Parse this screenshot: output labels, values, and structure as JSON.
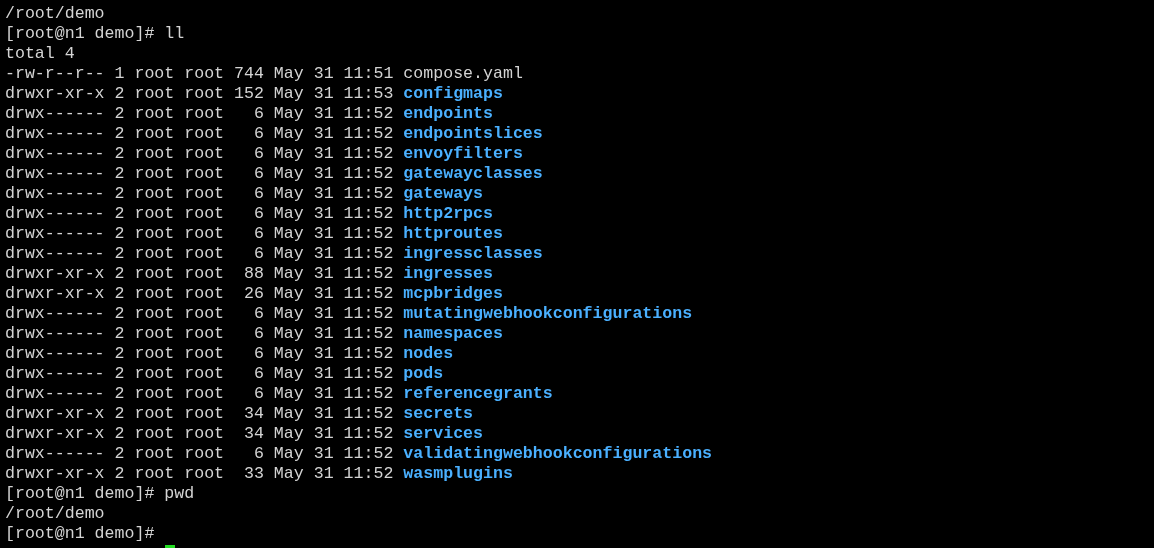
{
  "terminal": {
    "lines": [
      {
        "kind": "output",
        "text": "/root/demo"
      },
      {
        "kind": "prompt",
        "text": "[root@n1 demo]# ll"
      },
      {
        "kind": "output",
        "text": "total 4"
      },
      {
        "kind": "file",
        "meta": "-rw-r--r-- 1 root root 744 May 31 11:51",
        "name": "compose.yaml"
      },
      {
        "kind": "directory",
        "meta": "drwxr-xr-x 2 root root 152 May 31 11:53",
        "name": "configmaps"
      },
      {
        "kind": "directory",
        "meta": "drwx------ 2 root root   6 May 31 11:52",
        "name": "endpoints"
      },
      {
        "kind": "directory",
        "meta": "drwx------ 2 root root   6 May 31 11:52",
        "name": "endpointslices"
      },
      {
        "kind": "directory",
        "meta": "drwx------ 2 root root   6 May 31 11:52",
        "name": "envoyfilters"
      },
      {
        "kind": "directory",
        "meta": "drwx------ 2 root root   6 May 31 11:52",
        "name": "gatewayclasses"
      },
      {
        "kind": "directory",
        "meta": "drwx------ 2 root root   6 May 31 11:52",
        "name": "gateways"
      },
      {
        "kind": "directory",
        "meta": "drwx------ 2 root root   6 May 31 11:52",
        "name": "http2rpcs"
      },
      {
        "kind": "directory",
        "meta": "drwx------ 2 root root   6 May 31 11:52",
        "name": "httproutes"
      },
      {
        "kind": "directory",
        "meta": "drwx------ 2 root root   6 May 31 11:52",
        "name": "ingressclasses"
      },
      {
        "kind": "directory",
        "meta": "drwxr-xr-x 2 root root  88 May 31 11:52",
        "name": "ingresses"
      },
      {
        "kind": "directory",
        "meta": "drwxr-xr-x 2 root root  26 May 31 11:52",
        "name": "mcpbridges"
      },
      {
        "kind": "directory",
        "meta": "drwx------ 2 root root   6 May 31 11:52",
        "name": "mutatingwebhookconfigurations"
      },
      {
        "kind": "directory",
        "meta": "drwx------ 2 root root   6 May 31 11:52",
        "name": "namespaces"
      },
      {
        "kind": "directory",
        "meta": "drwx------ 2 root root   6 May 31 11:52",
        "name": "nodes"
      },
      {
        "kind": "directory",
        "meta": "drwx------ 2 root root   6 May 31 11:52",
        "name": "pods"
      },
      {
        "kind": "directory",
        "meta": "drwx------ 2 root root   6 May 31 11:52",
        "name": "referencegrants"
      },
      {
        "kind": "directory",
        "meta": "drwxr-xr-x 2 root root  34 May 31 11:52",
        "name": "secrets"
      },
      {
        "kind": "directory",
        "meta": "drwxr-xr-x 2 root root  34 May 31 11:52",
        "name": "services"
      },
      {
        "kind": "directory",
        "meta": "drwx------ 2 root root   6 May 31 11:52",
        "name": "validatingwebhookconfigurations"
      },
      {
        "kind": "directory",
        "meta": "drwxr-xr-x 2 root root  33 May 31 11:52",
        "name": "wasmplugins"
      },
      {
        "kind": "prompt",
        "text": "[root@n1 demo]# pwd"
      },
      {
        "kind": "output",
        "text": "/root/demo"
      },
      {
        "kind": "prompt",
        "text": "[root@n1 demo]#"
      }
    ]
  }
}
